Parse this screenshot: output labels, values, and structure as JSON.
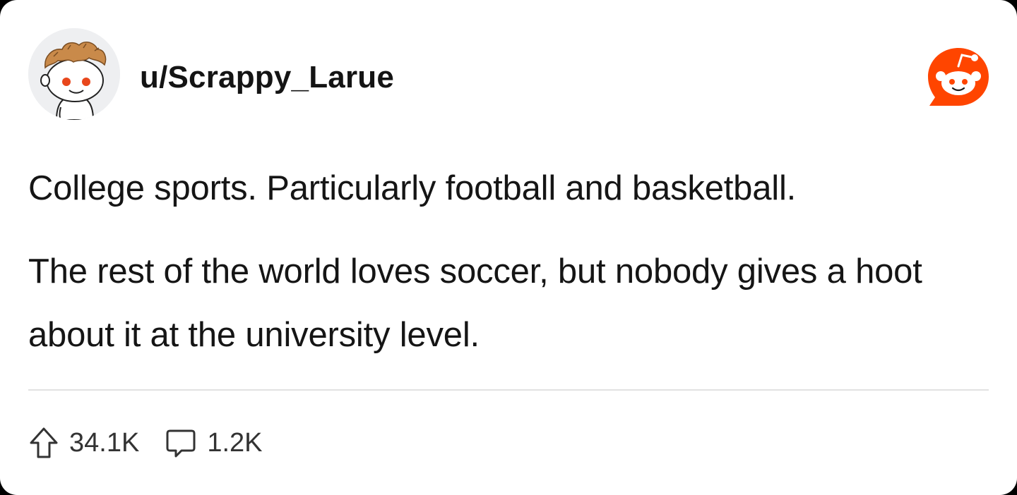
{
  "post": {
    "username": "u/Scrappy_Larue",
    "paragraphs": [
      "College sports. Particularly football and basketball.",
      "The rest of the world loves soccer, but nobody gives a hoot about it at the university level."
    ],
    "upvotes": "34.1K",
    "comments": "1.2K"
  },
  "icons": {
    "avatar": "reddit-snoo-avatar",
    "brand": "reddit-logo-icon",
    "upvote": "upvote-arrow-icon",
    "comment": "comment-bubble-icon"
  },
  "colors": {
    "brand": "#ff4500",
    "text": "#151515",
    "muted": "#333333",
    "card_background": "#ffffff",
    "page_background": "#000000"
  }
}
